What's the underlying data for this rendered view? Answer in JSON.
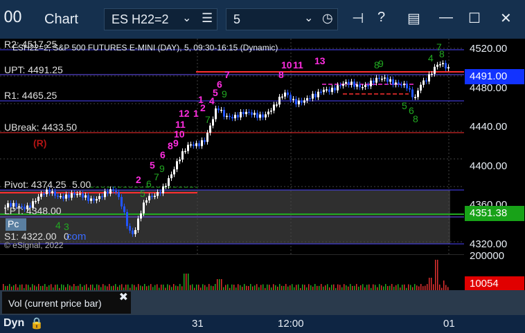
{
  "window": {
    "app_icon": "00",
    "title": "Chart",
    "symbol": "ES H22=2",
    "interval": "5"
  },
  "chart_header": "ESH22=2, S&P 500 FUTURES E-MINI (DAY), 5, 09:30-16:15 (Dynamic)",
  "copyright": "© eSignal, 2022",
  "r_marker": "(R)",
  "pc_badge": "Pc",
  "com_text": "com",
  "price_axis": {
    "ticks": [
      "4520.00",
      "4480.00",
      "4440.00",
      "4400.00",
      "4360.00",
      "4320.00"
    ],
    "current_price_tag": "4491.00",
    "green_tag": "4351.38"
  },
  "levels": [
    {
      "name": "R2",
      "label": "R2: 4517.25",
      "color": "#5a55ff"
    },
    {
      "name": "UPT",
      "label": "UPT: 4491.25",
      "color": "#ff3030"
    },
    {
      "name": "R1",
      "label": "R1: 4465.25",
      "color": "#5a55ff"
    },
    {
      "name": "UBreak",
      "label": "UBreak: 4433.50",
      "color": "#ff3030"
    },
    {
      "name": "Pivot",
      "label": "Pivot: 4374.25",
      "color": "#5a55ff"
    },
    {
      "name": "LPT",
      "label": "LPT: 4348.00",
      "color": "#ff3030"
    },
    {
      "name": "S1",
      "label": "S1: 4322.00",
      "color": "#5a55ff"
    }
  ],
  "extra_labels": {
    "pivot_tail": "5.00",
    "s1_tail": "0"
  },
  "volume": {
    "axis_top": "200000",
    "tag": "10054",
    "tab_label": "Vol (current price bar)"
  },
  "time_axis": {
    "mode": "Dyn",
    "labels": [
      "31",
      "12:00",
      "01"
    ]
  },
  "counts_magenta": [
    "2",
    "5",
    "6",
    "8",
    "9",
    "10",
    "11",
    "12",
    "1",
    "2",
    "4",
    "5",
    "6",
    "7",
    "8",
    "10",
    "11",
    "13"
  ],
  "counts_green": [
    "9",
    "7",
    "6",
    "5",
    "4",
    "3",
    "9",
    "7",
    "8",
    "9",
    "5",
    "6",
    "8",
    "4",
    "7",
    "8"
  ]
}
